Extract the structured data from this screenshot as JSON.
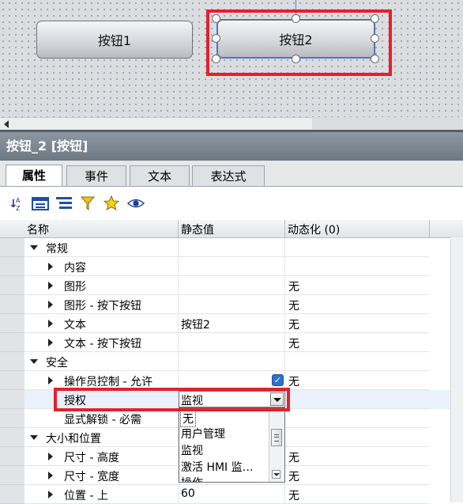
{
  "canvas": {
    "button1_label": "按钮1",
    "button2_label": "按钮2"
  },
  "panel": {
    "title": "按钮_2 [按钮]"
  },
  "tabs": [
    {
      "label": "属性",
      "active": true
    },
    {
      "label": "事件",
      "active": false
    },
    {
      "label": "文本",
      "active": false
    },
    {
      "label": "表达式",
      "active": false
    }
  ],
  "toolbar": {
    "icons": [
      "sort-az-icon",
      "show-categories-icon",
      "list-view-icon",
      "filter-icon",
      "favorites-star-icon",
      "visibility-eye-icon"
    ]
  },
  "grid": {
    "headers": {
      "name": "名称",
      "static": "静态值",
      "dynamic": "动态化 (0)"
    },
    "rows": [
      {
        "name": "常规",
        "value": "",
        "dyn": ""
      },
      {
        "name": "内容",
        "value": "",
        "dyn": ""
      },
      {
        "name": "图形",
        "value": "",
        "dyn": "无"
      },
      {
        "name": "图形 - 按下按钮",
        "value": "",
        "dyn": "无"
      },
      {
        "name": "文本",
        "value": "按钮2",
        "dyn": "无"
      },
      {
        "name": "文本 - 按下按钮",
        "value": "",
        "dyn": "无"
      },
      {
        "name": "安全",
        "value": "",
        "dyn": ""
      },
      {
        "name": "操作员控制 - 允许",
        "value": "",
        "dyn": "无"
      },
      {
        "name": "授权",
        "value": "",
        "dyn": ""
      },
      {
        "name": "显式解锁 - 必需",
        "value": "",
        "dyn": ""
      },
      {
        "name": "大小和位置",
        "value": "",
        "dyn": ""
      },
      {
        "name": "尺寸 - 高度",
        "value": "",
        "dyn": "无"
      },
      {
        "name": "尺寸 - 宽度",
        "value": "",
        "dyn": "无"
      },
      {
        "name": "位置 - 上",
        "value": "60",
        "dyn": "无"
      }
    ]
  },
  "authorization_combo": {
    "value": "监视",
    "options": [
      "无",
      "用户管理",
      "监视",
      "激活 HMI 监…",
      "操作"
    ]
  },
  "colors": {
    "highlight_red": "#e5202a",
    "selection_blue": "#3c7ad9"
  }
}
